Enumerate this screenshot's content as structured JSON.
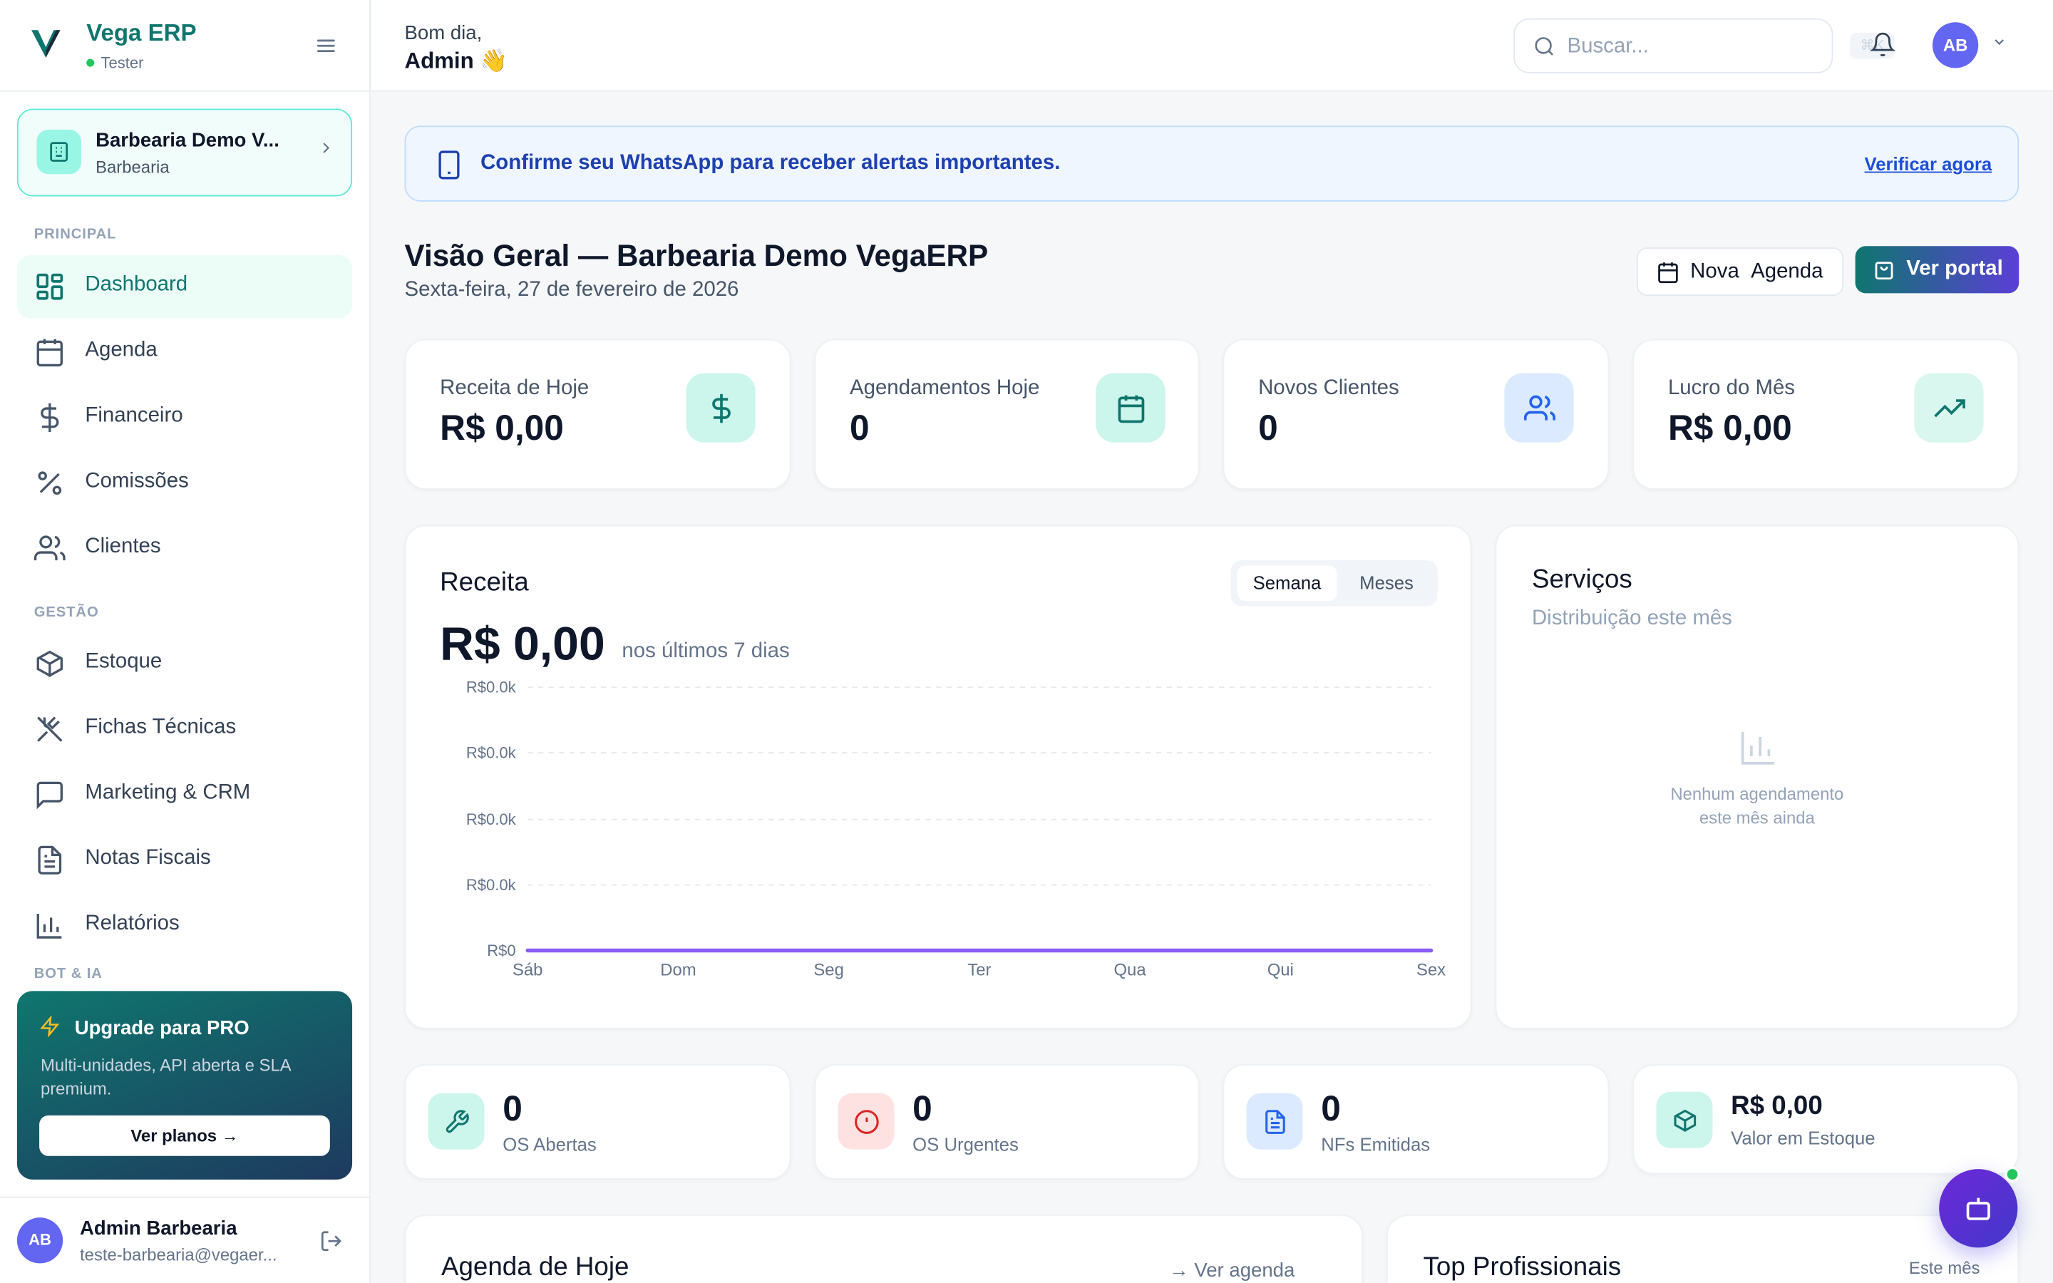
{
  "brand": {
    "name": "Vega ERP",
    "status": "Tester"
  },
  "company": {
    "name": "Barbearia Demo V...",
    "type": "Barbearia"
  },
  "sidebar": {
    "sections": [
      {
        "label": "PRINCIPAL"
      },
      {
        "label": "GESTÃO"
      },
      {
        "label": "BOT & IA"
      }
    ],
    "items": [
      {
        "label": "Dashboard",
        "icon": "dashboard-icon",
        "active": true
      },
      {
        "label": "Agenda",
        "icon": "calendar-icon"
      },
      {
        "label": "Financeiro",
        "icon": "dollar-icon"
      },
      {
        "label": "Comissões",
        "icon": "percent-icon"
      },
      {
        "label": "Clientes",
        "icon": "users-icon"
      },
      {
        "label": "Estoque",
        "icon": "package-icon"
      },
      {
        "label": "Fichas Técnicas",
        "icon": "utensils-icon"
      },
      {
        "label": "Marketing & CRM",
        "icon": "message-icon"
      },
      {
        "label": "Notas Fiscais",
        "icon": "file-text-icon"
      },
      {
        "label": "Relatórios",
        "icon": "bar-chart-icon"
      }
    ]
  },
  "upgrade": {
    "title": "Upgrade para PRO",
    "description": "Multi-unidades, API aberta e SLA premium.",
    "button": "Ver planos →"
  },
  "user": {
    "initials": "AB",
    "name": "Admin Barbearia",
    "email": "teste-barbearia@vegaer..."
  },
  "header": {
    "greeting": "Bom dia,",
    "name": "Admin 👋",
    "search_placeholder": "Buscar...",
    "shortcut": "⌘K",
    "avatar_initials": "AB"
  },
  "banner": {
    "text": "Confirme seu WhatsApp para receber alertas importantes.",
    "link": "Verificar agora"
  },
  "page": {
    "title": "Visão Geral — Barbearia Demo VegaERP",
    "date": "Sexta-feira, 27 de fevereiro de 2026"
  },
  "actions": {
    "agenda_word1": "Nova",
    "agenda_word2": "Agenda",
    "portal": "Ver portal"
  },
  "kpis": [
    {
      "label": "Receita de Hoje",
      "value": "R$ 0,00",
      "icon": "dollar-icon"
    },
    {
      "label": "Agendamentos Hoje",
      "value": "0",
      "icon": "calendar-icon"
    },
    {
      "label": "Novos Clientes",
      "value": "0",
      "icon": "users-icon"
    },
    {
      "label": "Lucro do Mês",
      "value": "R$ 0,00",
      "icon": "trending-up-icon"
    }
  ],
  "revenue": {
    "title": "Receita",
    "value": "R$ 0,00",
    "subtitle": "nos últimos 7 dias",
    "tabs": [
      "Semana",
      "Meses"
    ],
    "active_tab": "Semana"
  },
  "chart_data": {
    "type": "line",
    "x": [
      "Sáb",
      "Dom",
      "Seg",
      "Ter",
      "Qua",
      "Qui",
      "Sex"
    ],
    "series": [
      {
        "values": [
          0,
          0,
          0,
          0,
          0,
          0,
          0
        ],
        "color": "#8b5cf6"
      }
    ],
    "y_ticks": [
      "R$0",
      "R$0.0k",
      "R$0.0k",
      "R$0.0k",
      "R$0.0k"
    ],
    "ylim": [
      0,
      0
    ],
    "grid": true
  },
  "services": {
    "title": "Serviços",
    "subtitle": "Distribuição este mês",
    "empty_line1": "Nenhum agendamento",
    "empty_line2": "este mês ainda"
  },
  "stats": [
    {
      "value": "0",
      "label": "OS Abertas",
      "icon": "wrench-icon"
    },
    {
      "value": "0",
      "label": "OS Urgentes",
      "icon": "alert-circle-icon"
    },
    {
      "value": "0",
      "label": "NFs Emitidas",
      "icon": "file-text-icon"
    },
    {
      "value": "R$ 0,00",
      "label": "Valor em Estoque",
      "icon": "package-icon"
    }
  ],
  "agenda_hoje": {
    "title": "Agenda de Hoje",
    "link": "→ Ver agenda"
  },
  "top_prof": {
    "title": "Top Profissionais",
    "period": "Este mês"
  },
  "colors": {
    "primary": "#0f766e",
    "accent": "#8b5cf6",
    "banner": "#1e40af"
  }
}
